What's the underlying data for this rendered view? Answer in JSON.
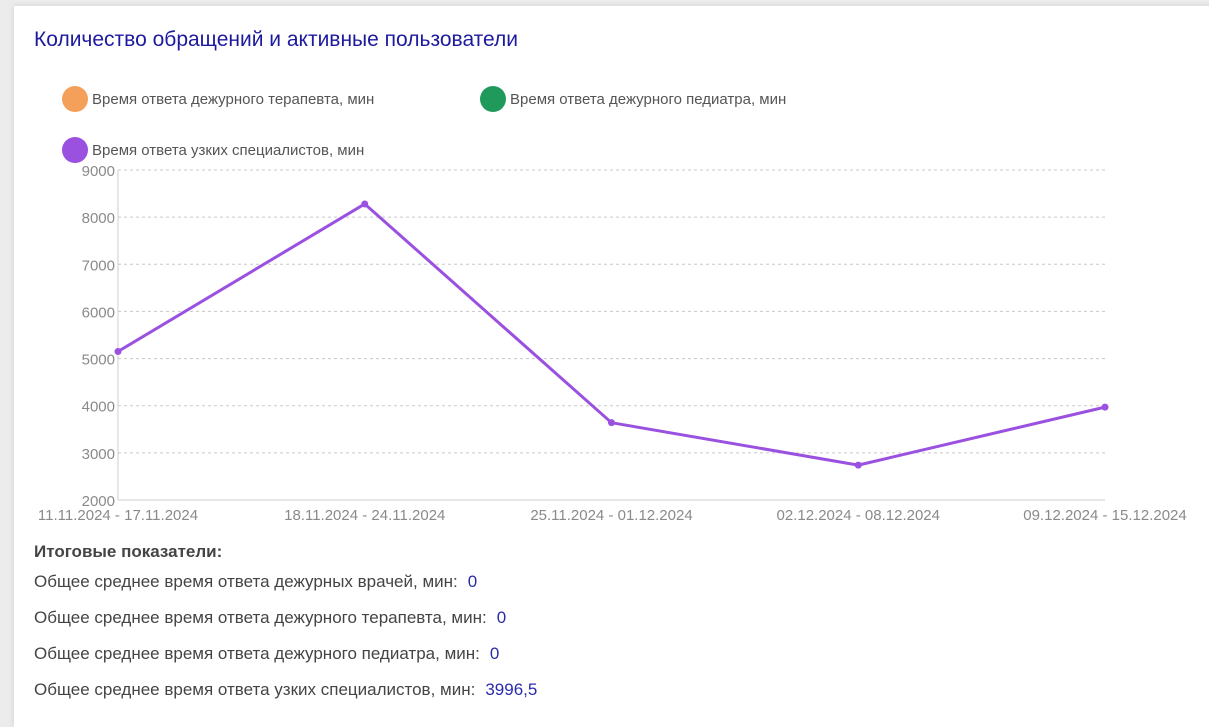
{
  "title": "Количество обращений и активные пользователи",
  "legend": [
    {
      "label": "Время ответа дежурного терапевта, мин",
      "color": "#f5a05a"
    },
    {
      "label": "Время ответа дежурного педиатра, мин",
      "color": "#1f9a5a"
    },
    {
      "label": "Время ответа узких специалистов, мин",
      "color": "#9b51e0"
    }
  ],
  "chart_data": {
    "type": "line",
    "categories": [
      "11.11.2024 - 17.11.2024",
      "18.11.2024 - 24.11.2024",
      "25.11.2024 - 01.12.2024",
      "02.12.2024 - 08.12.2024",
      "09.12.2024 - 15.12.2024"
    ],
    "series": [
      {
        "name": "Время ответа узких специалистов, мин",
        "color": "#9b51e0",
        "values": [
          5150,
          8280,
          3640,
          2740,
          3970
        ]
      }
    ],
    "ylim": [
      2000,
      9000
    ],
    "yticks": [
      "2000",
      "3000",
      "4000",
      "5000",
      "6000",
      "7000",
      "8000",
      "9000"
    ],
    "grid": true
  },
  "totals": {
    "heading": "Итоговые показатели:",
    "rows": [
      {
        "label": "Общее среднее время ответа дежурных врачей, мин:",
        "value": "0"
      },
      {
        "label": "Общее среднее время ответа дежурного терапевта, мин:",
        "value": "0"
      },
      {
        "label": "Общее среднее время ответа дежурного педиатра, мин:",
        "value": "0"
      },
      {
        "label": "Общее среднее время ответа узких специалистов, мин:",
        "value": "3996,5"
      }
    ]
  }
}
